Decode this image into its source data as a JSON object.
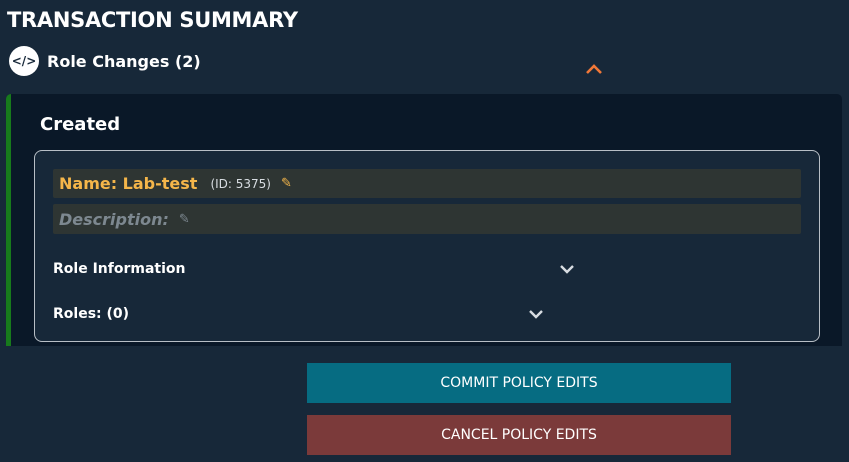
{
  "header": {
    "title": "TRANSACTION SUMMARY"
  },
  "section": {
    "label": "Role Changes (2)",
    "icon": "code-icon",
    "icon_glyph": "</>"
  },
  "panel": {
    "status": "Created",
    "name": "Name: Lab-test",
    "id": "(ID: 5375)",
    "description": "Description:",
    "role_information": "Role Information",
    "roles": "Roles: (0)"
  },
  "buttons": {
    "commit": "COMMIT POLICY EDITS",
    "cancel": "CANCEL POLICY EDITS"
  },
  "colors": {
    "accent": "#f5b64a",
    "created_bar": "#177a1c",
    "commit": "#066c82",
    "cancel": "#7b3a3a",
    "collapse": "#f07838"
  }
}
